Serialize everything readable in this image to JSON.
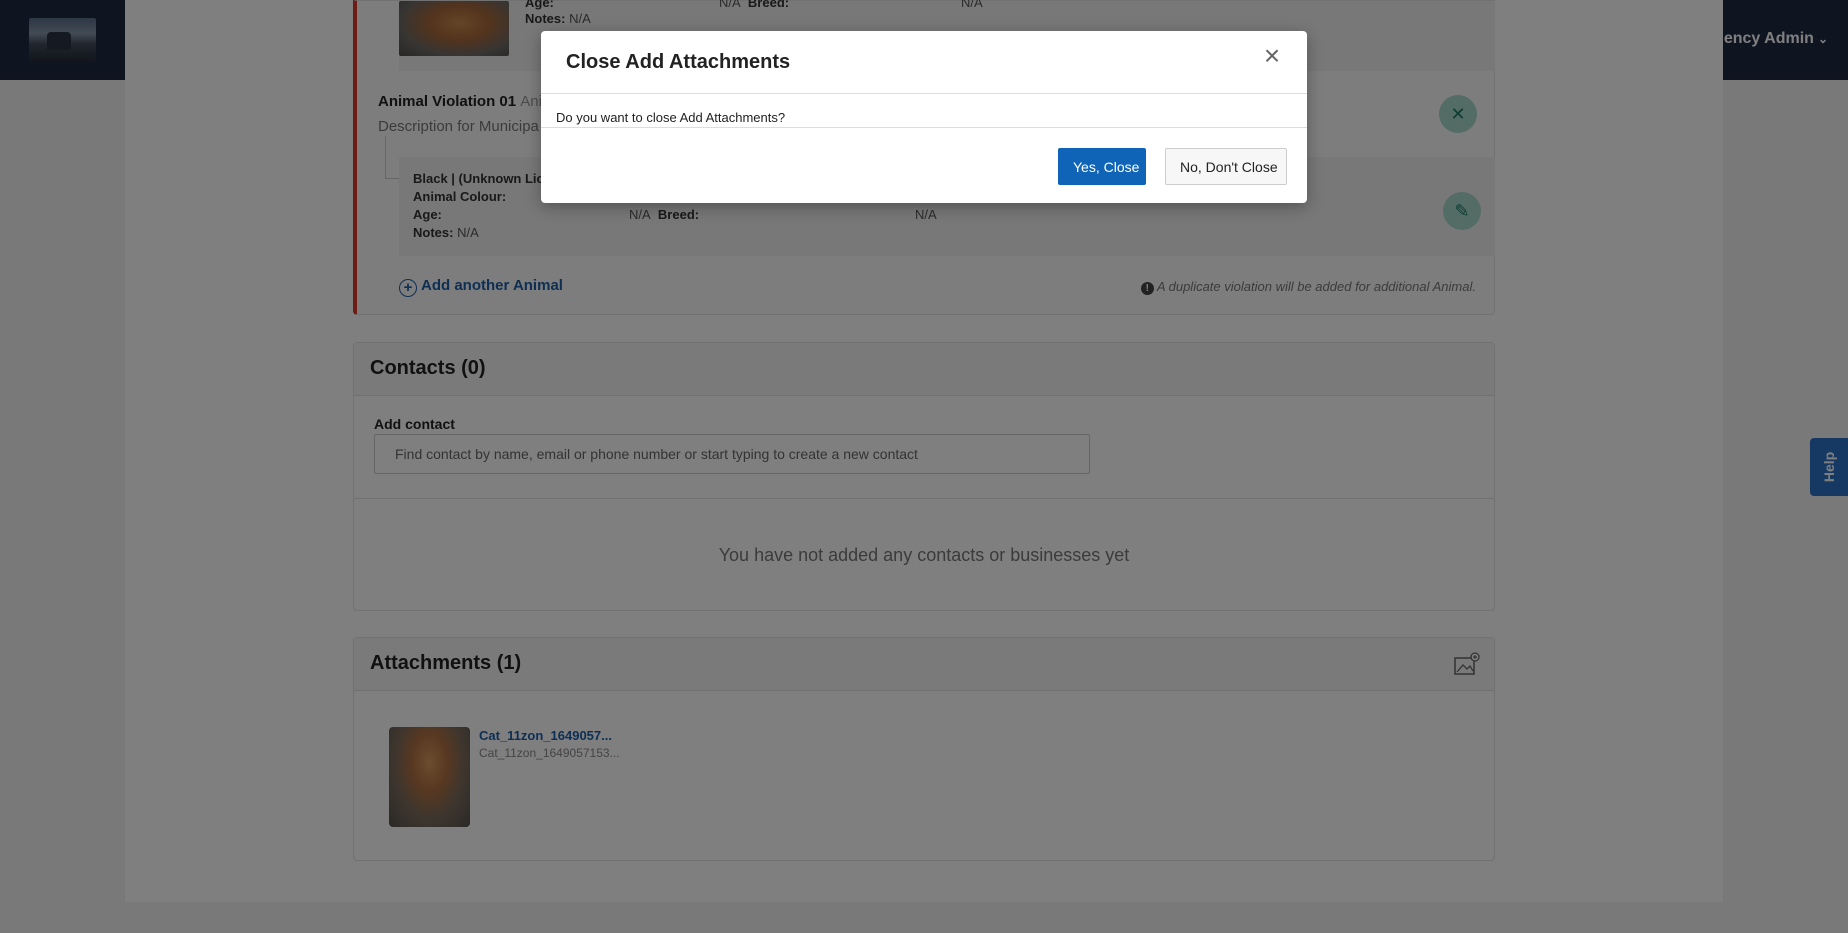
{
  "header": {
    "user_menu_label": "ency Admin"
  },
  "violation": {
    "top_animal": {
      "age_label": "Age:",
      "age_value": "N/A",
      "breed_label": "Breed:",
      "breed_value": "N/A",
      "notes_label": "Notes:",
      "notes_value": "N/A"
    },
    "title": "Animal Violation 01",
    "title_suffix": "Ani",
    "description": "Description for Municipa",
    "animal": {
      "name": "Black | (Unknown Lic",
      "colour_label": "Animal Colour:",
      "age_label": "Age:",
      "age_value": "N/A",
      "breed_label": "Breed:",
      "breed_value": "N/A",
      "notes_label": "Notes:",
      "notes_value": "N/A"
    },
    "add_animal_label": "Add another Animal",
    "duplicate_note": "A duplicate violation will be added for additional Animal."
  },
  "contacts": {
    "title": "Contacts (0)",
    "add_label": "Add contact",
    "search_placeholder": "Find contact by name, email or phone number or start typing to create a new contact",
    "empty_message": "You have not added any contacts or businesses yet"
  },
  "attachments": {
    "title": "Attachments (1)",
    "items": [
      {
        "name": "Cat_11zon_1649057...",
        "filename": "Cat_11zon_1649057153..."
      }
    ]
  },
  "help_label": "Help",
  "modal": {
    "title": "Close Add Attachments",
    "close_icon": "×",
    "message": "Do you want to close Add Attachments?",
    "confirm_label": "Yes, Close",
    "cancel_label": "No, Don't Close"
  },
  "colors": {
    "primary": "#0f64b8",
    "nav_bg": "#1d2b43",
    "violation_accent": "#d9362b",
    "action_green": "#1a7a63"
  }
}
